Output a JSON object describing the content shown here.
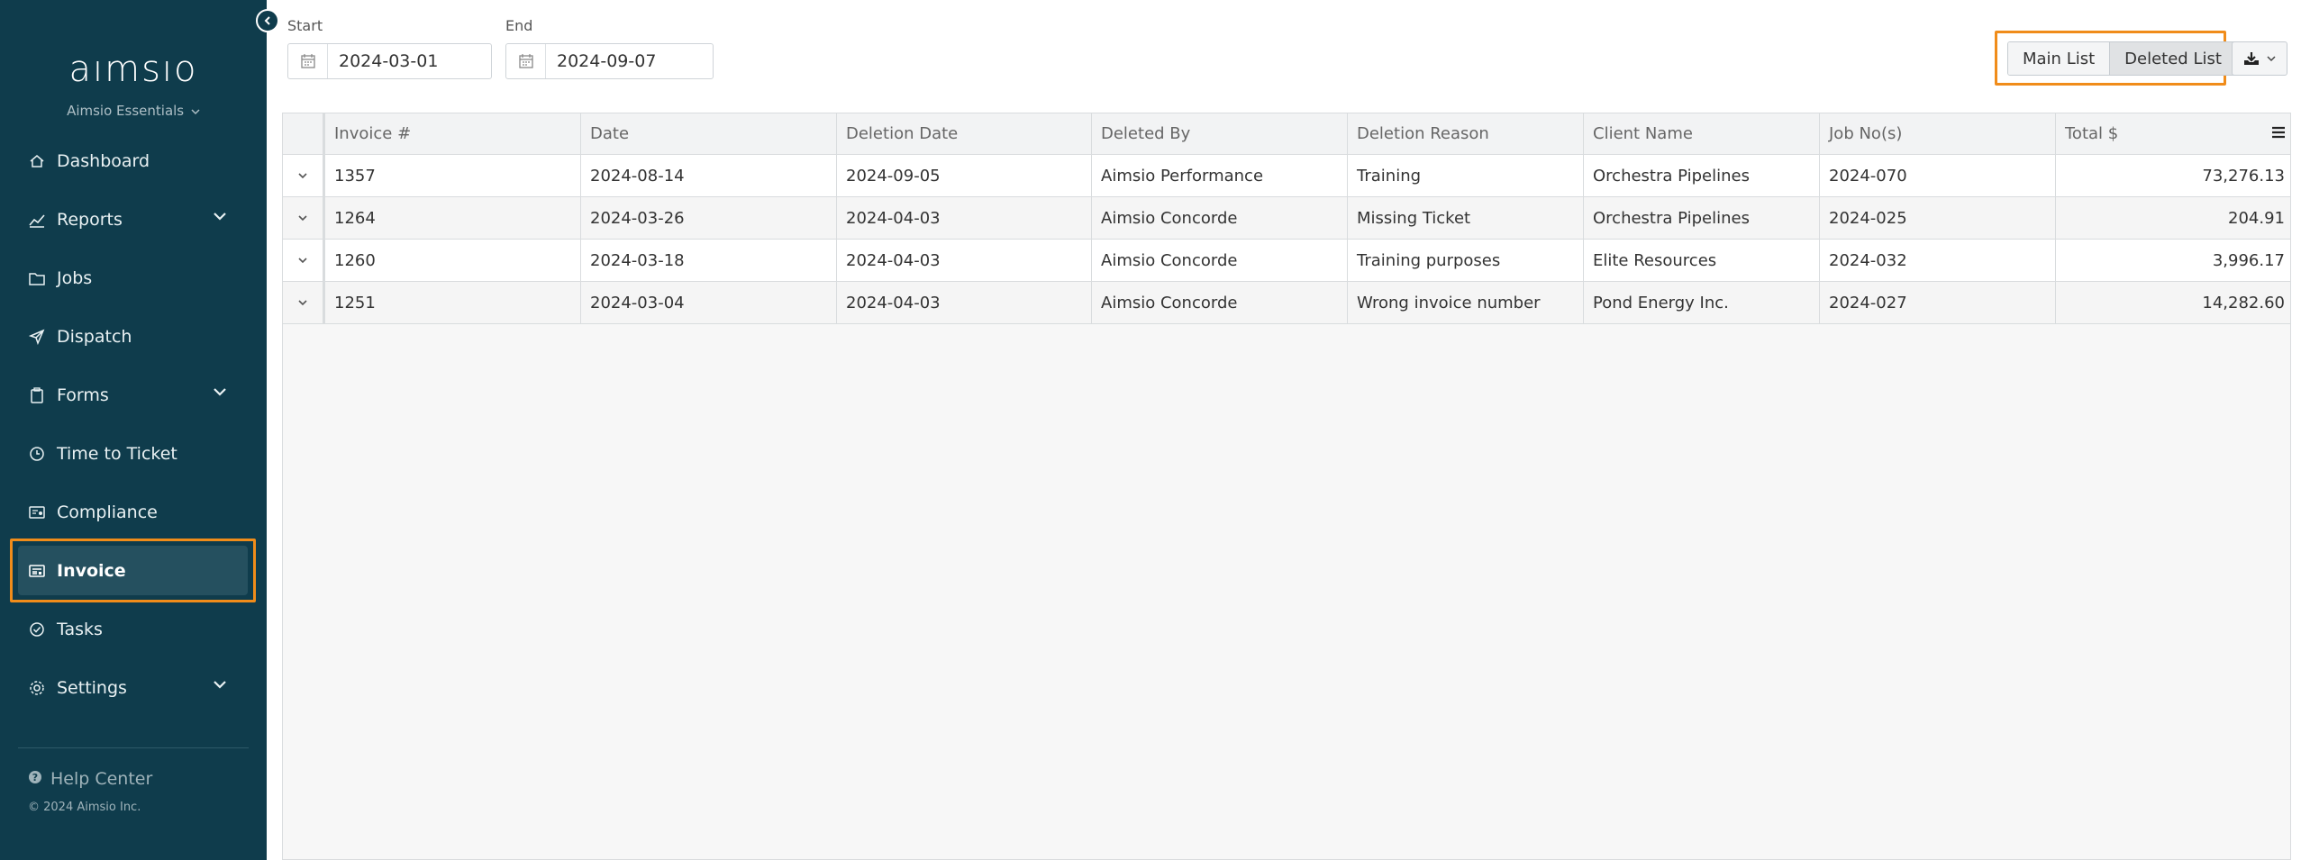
{
  "sidebar": {
    "logo": "aımsıo",
    "product": "Aimsio Essentials",
    "items": [
      {
        "label": "Dashboard",
        "icon": "home-icon",
        "expandable": false
      },
      {
        "label": "Reports",
        "icon": "chart-icon",
        "expandable": true
      },
      {
        "label": "Jobs",
        "icon": "folder-icon",
        "expandable": false
      },
      {
        "label": "Dispatch",
        "icon": "paper-plane-icon",
        "expandable": false
      },
      {
        "label": "Forms",
        "icon": "clipboard-icon",
        "expandable": true
      },
      {
        "label": "Time to Ticket",
        "icon": "clock-icon",
        "expandable": false
      },
      {
        "label": "Compliance",
        "icon": "compliance-icon",
        "expandable": false
      },
      {
        "label": "Invoice",
        "icon": "invoice-icon",
        "expandable": false,
        "active": true
      },
      {
        "label": "Tasks",
        "icon": "check-circle-icon",
        "expandable": false
      },
      {
        "label": "Settings",
        "icon": "gear-icon",
        "expandable": true
      }
    ],
    "help": "Help Center",
    "copyright": "© 2024 Aimsio Inc."
  },
  "filters": {
    "start_label": "Start",
    "start_value": "2024-03-01",
    "end_label": "End",
    "end_value": "2024-09-07"
  },
  "toggle": {
    "main_list": "Main List",
    "deleted_list": "Deleted List",
    "selected": "Deleted List"
  },
  "grid": {
    "columns": [
      "Invoice #",
      "Date",
      "Deletion Date",
      "Deleted By",
      "Deletion Reason",
      "Client Name",
      "Job No(s)",
      "Total $"
    ],
    "rows": [
      [
        "1357",
        "2024-08-14",
        "2024-09-05",
        "Aimsio Performance",
        "Training",
        "Orchestra Pipelines",
        "2024-070",
        "73,276.13"
      ],
      [
        "1264",
        "2024-03-26",
        "2024-04-03",
        "Aimsio Concorde",
        "Missing Ticket",
        "Orchestra Pipelines",
        "2024-025",
        "204.91"
      ],
      [
        "1260",
        "2024-03-18",
        "2024-04-03",
        "Aimsio Concorde",
        "Training purposes",
        "Elite Resources",
        "2024-032",
        "3,996.17"
      ],
      [
        "1251",
        "2024-03-04",
        "2024-04-03",
        "Aimsio Concorde",
        "Wrong invoice number",
        "Pond Energy Inc.",
        "2024-027",
        "14,282.60"
      ]
    ]
  },
  "colors": {
    "sidebar_bg": "#0f3c4c",
    "highlight": "#f08c1a"
  }
}
